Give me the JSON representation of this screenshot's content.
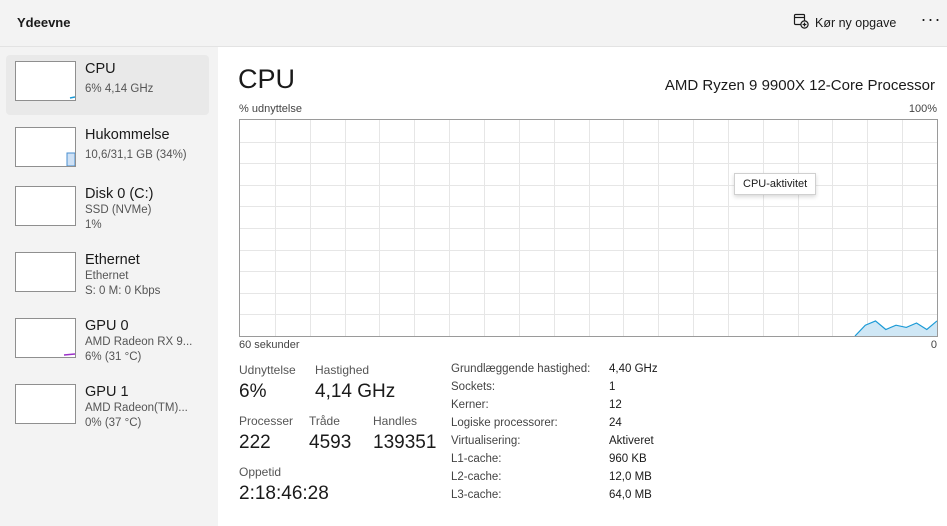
{
  "app": {
    "title": "Ydeevne"
  },
  "toolbar": {
    "run_task_label": "Kør ny opgave",
    "more_label": "···"
  },
  "sidebar": {
    "items": [
      {
        "name": "CPU",
        "line1": "6% 4,14 GHz",
        "line2": ""
      },
      {
        "name": "Hukommelse",
        "line1": "10,6/31,1 GB (34%)",
        "line2": ""
      },
      {
        "name": "Disk 0 (C:)",
        "line1": "SSD (NVMe)",
        "line2": "1%"
      },
      {
        "name": "Ethernet",
        "line1": "Ethernet",
        "line2": "S: 0 M: 0 Kbps"
      },
      {
        "name": "GPU 0",
        "line1": "AMD Radeon RX 9...",
        "line2": "6% (31 °C)"
      },
      {
        "name": "GPU 1",
        "line1": "AMD Radeon(TM)...",
        "line2": "0% (37 °C)"
      }
    ]
  },
  "main": {
    "title": "CPU",
    "processor": "AMD Ryzen 9 9900X 12-Core Processor",
    "graph": {
      "top_left": "% udnyttelse",
      "top_right": "100%",
      "bottom_left": "60 sekunder",
      "bottom_right": "0",
      "tooltip": "CPU-aktivitet",
      "ylim": [
        0,
        100
      ],
      "recent_utilization": [
        0,
        5,
        7,
        3,
        5,
        4,
        6,
        3,
        7
      ]
    },
    "stats": {
      "utilization_label": "Udnyttelse",
      "utilization": "6%",
      "speed_label": "Hastighed",
      "speed": "4,14 GHz",
      "processes_label": "Processer",
      "processes": "222",
      "threads_label": "Tråde",
      "threads": "4593",
      "handles_label": "Handles",
      "handles": "139351",
      "uptime_label": "Oppetid",
      "uptime": "2:18:46:28"
    },
    "specs": [
      {
        "label": "Grundlæggende hastighed:",
        "value": "4,40 GHz"
      },
      {
        "label": "Sockets:",
        "value": "1"
      },
      {
        "label": "Kerner:",
        "value": "12"
      },
      {
        "label": "Logiske processorer:",
        "value": "24"
      },
      {
        "label": "Virtualisering:",
        "value": "Aktiveret"
      },
      {
        "label": "L1-cache:",
        "value": "960 KB"
      },
      {
        "label": "L2-cache:",
        "value": "12,0 MB"
      },
      {
        "label": "L3-cache:",
        "value": "64,0 MB"
      }
    ]
  },
  "colors": {
    "cpu": "#1b9ad6",
    "memory": "#4a8fd0",
    "gpu": "#9b30c8",
    "grid": "#e6e6e6",
    "cpu_fill": "#cfe7f5"
  }
}
